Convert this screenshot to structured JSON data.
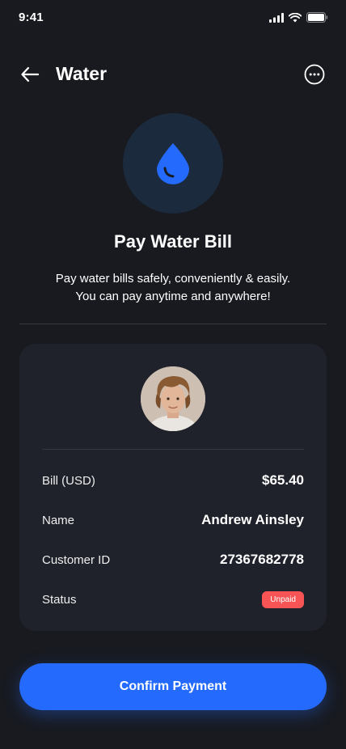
{
  "status_bar": {
    "time": "9:41"
  },
  "header": {
    "title": "Water",
    "back_icon": "arrow-left-icon",
    "more_icon": "more-circle-icon"
  },
  "hero": {
    "icon": "water-drop-icon",
    "title": "Pay Water Bill",
    "description_line1": "Pay water bills safely, conveniently & easily.",
    "description_line2": "You can pay anytime and anywhere!"
  },
  "bill": {
    "rows": [
      {
        "label": "Bill (USD)",
        "value": "$65.40"
      },
      {
        "label": "Name",
        "value": "Andrew Ainsley"
      },
      {
        "label": "Customer ID",
        "value": "27367682778"
      },
      {
        "label": "Status",
        "value": "Unpaid"
      }
    ]
  },
  "confirm_button": {
    "label": "Confirm Payment"
  },
  "colors": {
    "background": "#181a20",
    "card": "#1f222a",
    "accent": "#246bfd",
    "status_unpaid": "#f75555"
  }
}
